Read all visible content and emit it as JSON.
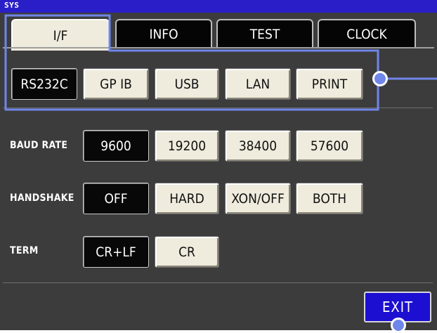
{
  "window": {
    "title": "SYS"
  },
  "tabs": [
    {
      "label": "I/F",
      "active": true
    },
    {
      "label": "INFO",
      "active": false
    },
    {
      "label": "TEST",
      "active": false
    },
    {
      "label": "CLOCK",
      "active": false
    }
  ],
  "interfaces": {
    "options": [
      "RS232C",
      "GP IB",
      "USB",
      "LAN",
      "PRINT"
    ],
    "selected": "RS232C"
  },
  "baud_rate": {
    "label": "BAUD RATE",
    "options": [
      "9600",
      "19200",
      "38400",
      "57600"
    ],
    "selected": "9600"
  },
  "handshake": {
    "label": "HANDSHAKE",
    "options": [
      "OFF",
      "HARD",
      "XON/OFF",
      "BOTH"
    ],
    "selected": "OFF"
  },
  "term": {
    "label": "TERM",
    "options": [
      "CR+LF",
      "CR"
    ],
    "selected": "CR+LF"
  },
  "exit_label": "EXIT",
  "colors": {
    "titlebar": "#2a1ec8",
    "background": "#3c3c3c",
    "button_face": "#efebdd",
    "button_selected": "#080808",
    "exit_button": "#1c0fd2",
    "callout": "#6f86ea"
  }
}
